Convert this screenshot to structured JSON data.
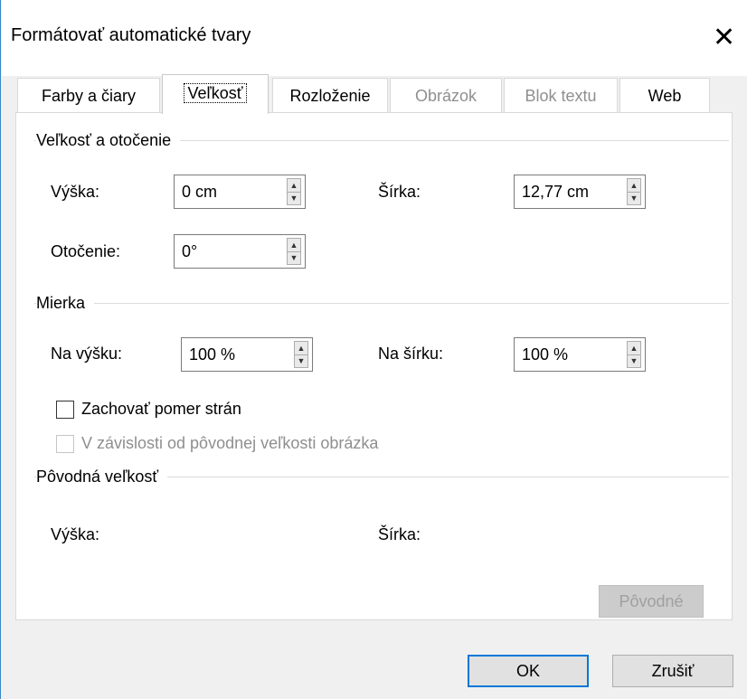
{
  "dialog": {
    "title": "Formátovať automatické tvary",
    "close_glyph": "✕"
  },
  "tabs": [
    {
      "label": "Farby a čiary",
      "state": "normal"
    },
    {
      "label": "Veľkosť",
      "state": "selected"
    },
    {
      "label": "Rozloženie",
      "state": "normal"
    },
    {
      "label": "Obrázok",
      "state": "disabled"
    },
    {
      "label": "Blok textu",
      "state": "disabled"
    },
    {
      "label": "Web",
      "state": "normal"
    }
  ],
  "size_rotate": {
    "heading": "Veľkosť a otočenie",
    "height_label": "Výška:",
    "height_value": "0 cm",
    "width_label": "Šírka:",
    "width_value": "12,77 cm",
    "rotation_label": "Otočenie:",
    "rotation_value": "0°"
  },
  "scale": {
    "heading": "Mierka",
    "height_label": "Na výšku:",
    "height_value": "100 %",
    "width_label": "Na šírku:",
    "width_value": "100 %",
    "lock_aspect_label": "Zachovať pomer strán",
    "lock_aspect_checked": false,
    "relative_label": "V závislosti od pôvodnej veľkosti obrázka",
    "relative_checked": false
  },
  "original": {
    "heading": "Pôvodná veľkosť",
    "height_label": "Výška:",
    "width_label": "Šírka:",
    "reset_label": "Pôvodné"
  },
  "buttons": {
    "ok": "OK",
    "cancel": "Zrušiť"
  },
  "colors": {
    "accent": "#0078d7",
    "window_border": "#3c86c8",
    "disabled_text": "#8f8f8f"
  }
}
